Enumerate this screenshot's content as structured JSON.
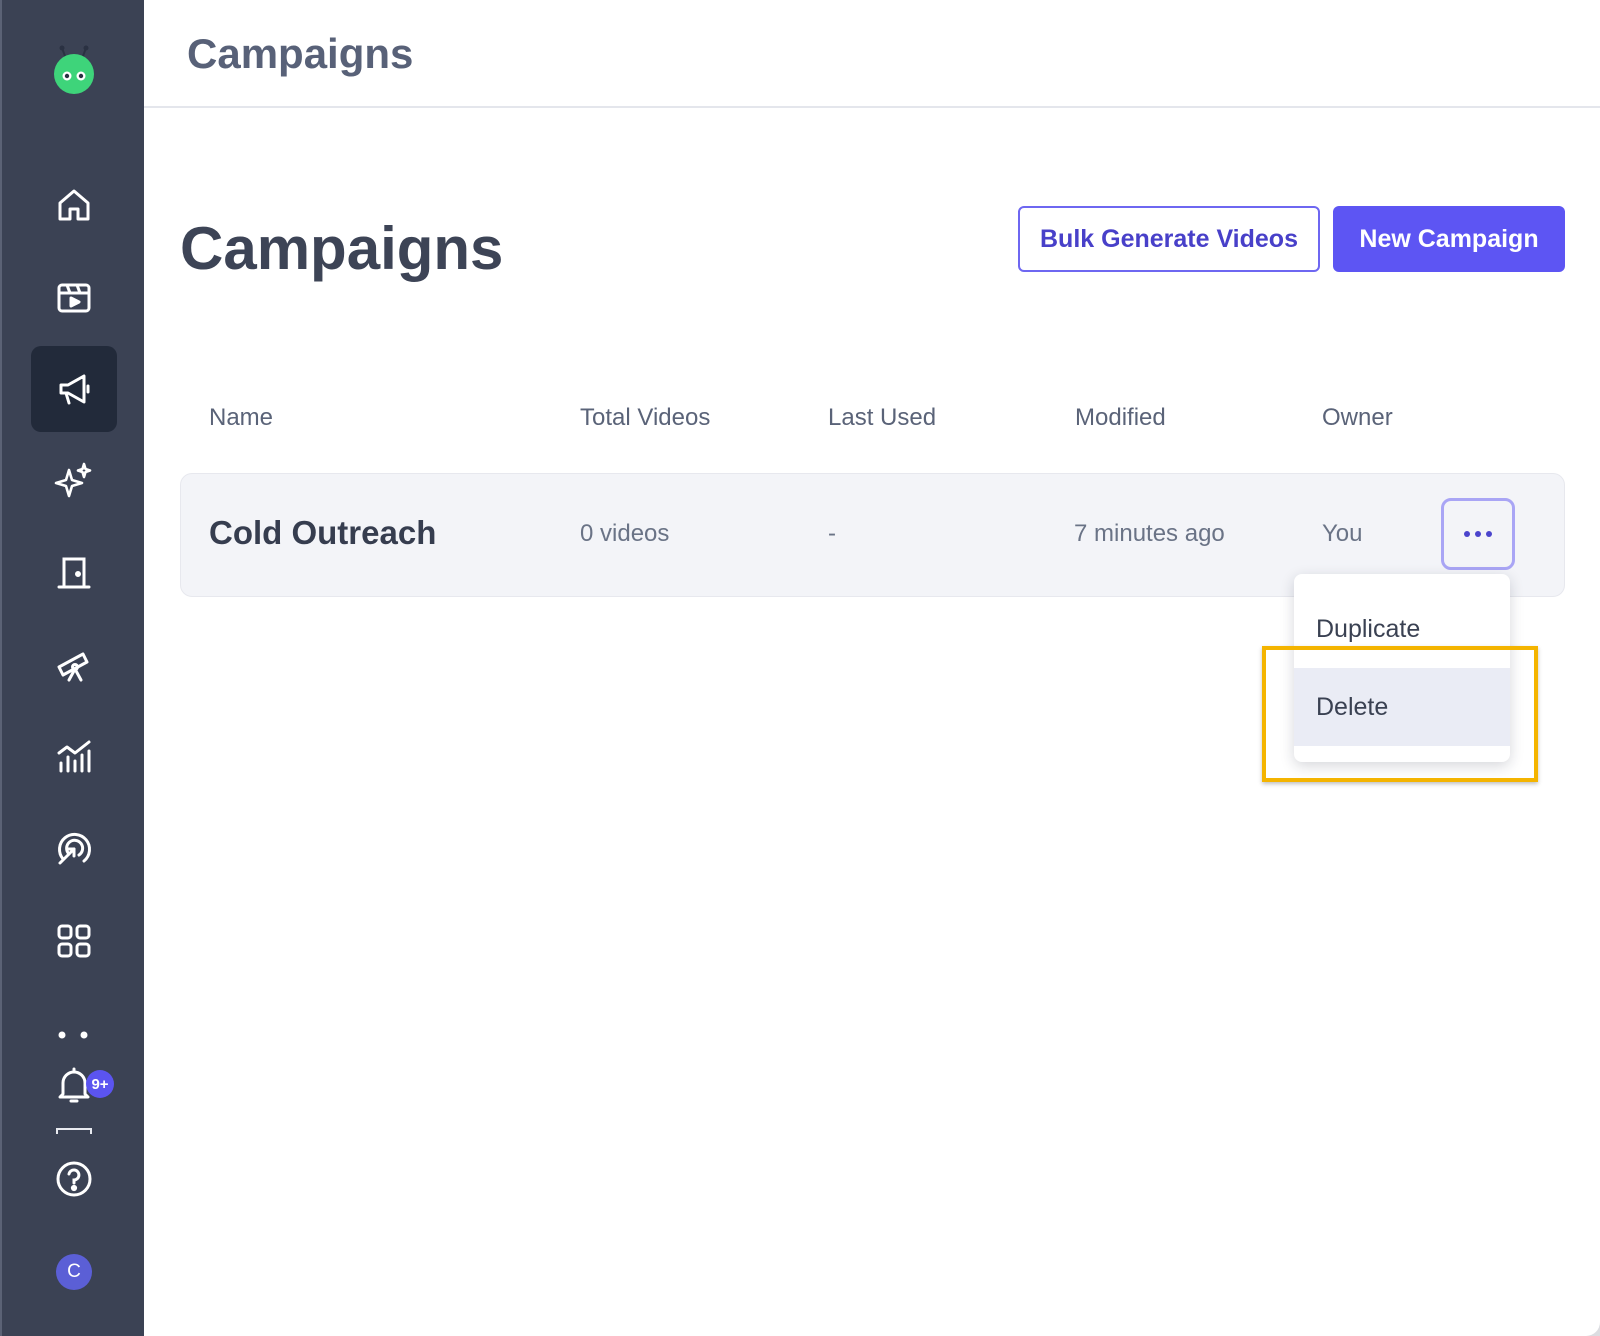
{
  "topbar": {
    "title": "Campaigns"
  },
  "page": {
    "title": "Campaigns",
    "bulk_button": "Bulk Generate Videos",
    "new_button": "New Campaign"
  },
  "table": {
    "columns": [
      "Name",
      "Total Videos",
      "Last Used",
      "Modified",
      "Owner"
    ],
    "rows": [
      {
        "name": "Cold Outreach",
        "total_videos": "0 videos",
        "last_used": "-",
        "modified": "7 minutes ago",
        "owner": "You"
      }
    ]
  },
  "row_menu": {
    "items": [
      "Duplicate",
      "Delete"
    ],
    "highlighted": "Delete"
  },
  "sidebar": {
    "items": [
      {
        "icon": "home-icon"
      },
      {
        "icon": "video-clapper-icon"
      },
      {
        "icon": "megaphone-icon",
        "active": true
      },
      {
        "icon": "sparkles-icon"
      },
      {
        "icon": "door-icon"
      },
      {
        "icon": "telescope-icon"
      },
      {
        "icon": "analytics-chart-icon"
      },
      {
        "icon": "target-cursor-icon"
      },
      {
        "icon": "apps-grid-icon"
      }
    ],
    "notification_badge": "9+",
    "avatar_letter": "C"
  },
  "colors": {
    "accent": "#5d55f3",
    "sidebar_bg": "#3b4254",
    "highlight": "#f4b400"
  }
}
